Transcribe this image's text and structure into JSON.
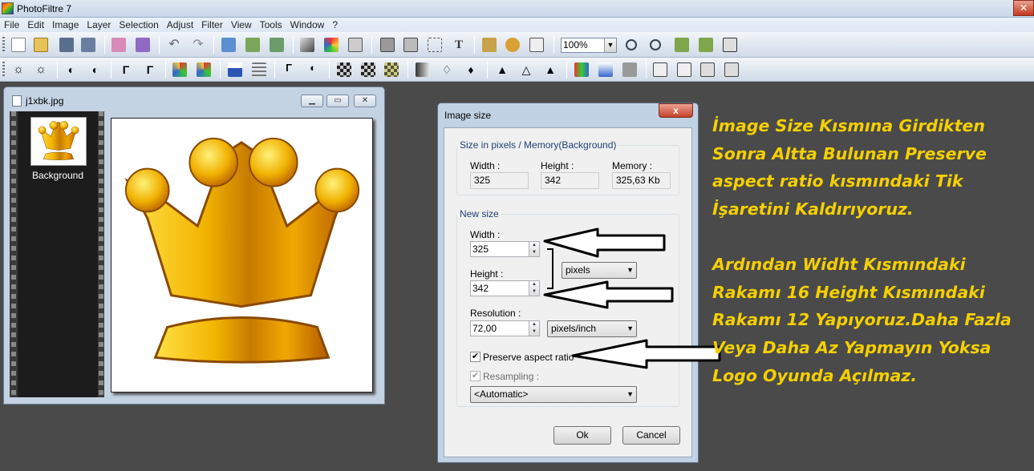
{
  "app": {
    "title": "PhotoFiltre 7"
  },
  "menu": [
    "File",
    "Edit",
    "Image",
    "Layer",
    "Selection",
    "Adjust",
    "Filter",
    "View",
    "Tools",
    "Window",
    "?"
  ],
  "toolbar": {
    "zoom": "100%"
  },
  "image_window": {
    "title": "j1xbk.jpg",
    "layer_name": "Background"
  },
  "dialog": {
    "title": "Image size",
    "close_label": "x",
    "size_group": {
      "legend": "Size in pixels / Memory(Background)",
      "width_label": "Width :",
      "width_value": "325",
      "height_label": "Height :",
      "height_value": "342",
      "memory_label": "Memory :",
      "memory_value": "325,63 Kb"
    },
    "new_size_group": {
      "legend": "New size",
      "width_label": "Width :",
      "width_value": "325",
      "height_label": "Height :",
      "height_value": "342",
      "unit": "pixels",
      "resolution_label": "Resolution :",
      "resolution_value": "72,00",
      "resolution_unit": "pixels/inch",
      "preserve_label": "Preserve aspect ratio",
      "preserve_checked": true,
      "resampling_label": "Resampling :",
      "resampling_checked": true,
      "resampling_value": "<Automatic>"
    },
    "ok_label": "Ok",
    "cancel_label": "Cancel"
  },
  "annotation": {
    "paragraph1": "İmage Size Kısmına Girdikten Sonra Altta Bulunan Preserve aspect ratio kısmındaki Tik İşaretini Kaldırıyoruz.",
    "paragraph2": "Ardından Widht Kısmındaki Rakamı 16 Height Kısmındaki Rakamı 12 Yapıyoruz.Daha Fazla Veya Daha Az Yapmayın Yoksa Logo Oyunda Açılmaz."
  },
  "colors": {
    "annotation_text": "#f5d000",
    "workspace": "#4a4a4a",
    "crown_gold": "#e6a400"
  }
}
